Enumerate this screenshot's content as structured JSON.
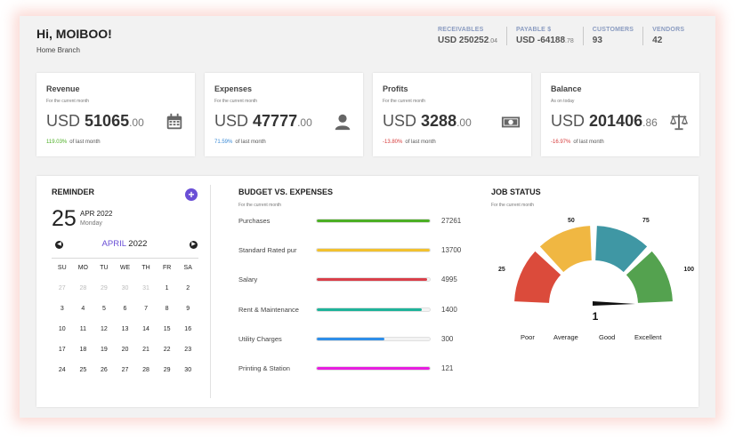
{
  "header": {
    "greeting": "Hi, MOIBOO!",
    "branch": "Home Branch",
    "stats": [
      {
        "label": "RECEIVABLES",
        "value": "USD 250252",
        "decimals": ".04"
      },
      {
        "label": "PAYABLE $",
        "value": "USD -64188",
        "decimals": ".78"
      },
      {
        "label": "CUSTOMERS",
        "value": "93",
        "decimals": ""
      },
      {
        "label": "VENDORS",
        "value": "42",
        "decimals": ""
      }
    ]
  },
  "cards": [
    {
      "title": "Revenue",
      "sub": "For the current month",
      "currency": "USD",
      "amount": "51065",
      "decimals": ".00",
      "pct": "119.03%",
      "pct_suffix": "of last month",
      "icon": "calendar-icon"
    },
    {
      "title": "Expenses",
      "sub": "For the current month",
      "currency": "USD",
      "amount": "47777",
      "decimals": ".00",
      "pct": "71.59%",
      "pct_suffix": "of last month",
      "icon": "user-icon"
    },
    {
      "title": "Profits",
      "sub": "For the current month",
      "currency": "USD",
      "amount": "3288",
      "decimals": ".00",
      "pct": "-13.80%",
      "pct_suffix": "of last month",
      "icon": "money-bill-icon"
    },
    {
      "title": "Balance",
      "sub": "As on today",
      "currency": "USD",
      "amount": "201406",
      "decimals": ".86",
      "pct": "-16.97%",
      "pct_suffix": "of last month",
      "icon": "scale-icon"
    }
  ],
  "reminder": {
    "title": "REMINDER",
    "add_label": "+",
    "day": "25",
    "month_year": "APR 2022",
    "weekday": "Monday",
    "cal_month": "APRIL",
    "cal_year": "2022",
    "weekdays": [
      "SU",
      "MO",
      "TU",
      "WE",
      "TH",
      "FR",
      "SA"
    ],
    "days": [
      {
        "d": "27",
        "muted": true
      },
      {
        "d": "28",
        "muted": true
      },
      {
        "d": "29",
        "muted": true
      },
      {
        "d": "30",
        "muted": true
      },
      {
        "d": "31",
        "muted": true
      },
      {
        "d": "1"
      },
      {
        "d": "2"
      },
      {
        "d": "3"
      },
      {
        "d": "4"
      },
      {
        "d": "5"
      },
      {
        "d": "6"
      },
      {
        "d": "7"
      },
      {
        "d": "8"
      },
      {
        "d": "9"
      },
      {
        "d": "10"
      },
      {
        "d": "11"
      },
      {
        "d": "12"
      },
      {
        "d": "13"
      },
      {
        "d": "14"
      },
      {
        "d": "15"
      },
      {
        "d": "16"
      },
      {
        "d": "17"
      },
      {
        "d": "18"
      },
      {
        "d": "19"
      },
      {
        "d": "20"
      },
      {
        "d": "21"
      },
      {
        "d": "22"
      },
      {
        "d": "23"
      },
      {
        "d": "24"
      },
      {
        "d": "25"
      },
      {
        "d": "26"
      },
      {
        "d": "27"
      },
      {
        "d": "28"
      },
      {
        "d": "29"
      },
      {
        "d": "30"
      }
    ]
  },
  "budget": {
    "title": "BUDGET VS. EXPENSES",
    "sub": "For the current month",
    "rows": [
      {
        "name": "Purchases",
        "value": "27261",
        "fill": 1.0,
        "color": "#4caf24"
      },
      {
        "name": "Standard Rated pur",
        "value": "13700",
        "fill": 1.0,
        "color": "#f2c12e"
      },
      {
        "name": "Salary",
        "value": "4995",
        "fill": 0.98,
        "color": "#d9404a"
      },
      {
        "name": "Rent & Maintenance",
        "value": "1400",
        "fill": 0.93,
        "color": "#1fb39a"
      },
      {
        "name": "Utility Charges",
        "value": "300",
        "fill": 0.6,
        "color": "#2f8ee8"
      },
      {
        "name": "Printing & Station",
        "value": "121",
        "fill": 1.0,
        "color": "#e81ee0"
      }
    ]
  },
  "job": {
    "title": "JOB STATUS",
    "sub": "For the current month",
    "value": "1",
    "ticks": [
      "25",
      "50",
      "75",
      "100"
    ],
    "legend": [
      "Poor",
      "Average",
      "Good",
      "Excellent"
    ],
    "colors": [
      "#db4b3b",
      "#f0b742",
      "#3f97a4",
      "#54a24f"
    ]
  }
}
